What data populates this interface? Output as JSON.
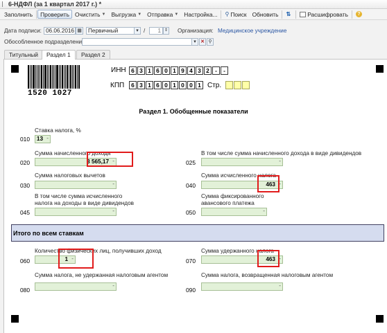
{
  "window": {
    "title": "6-НДФЛ (за 1 квартал 2017 г.) *"
  },
  "toolbar": {
    "fill": "Заполнить",
    "check": "Проверить",
    "clear": "Очистить",
    "export": "Выгрузка",
    "send": "Отправка",
    "settings": "Настройка...",
    "search": "Поиск",
    "refresh": "Обновить",
    "decode": "Расшифровать"
  },
  "header": {
    "date_label": "Дата подписи:",
    "date_value": "06.06.2016",
    "type_value": "Первичный",
    "slash": "/",
    "correction_value": "1",
    "org_label": "Организация:",
    "org_value": "Медицинское учреждение",
    "subdiv_label": "Обособленное подразделение:",
    "subdiv_value": ""
  },
  "tabs": [
    {
      "label": "Титульный"
    },
    {
      "label": "Раздел 1"
    },
    {
      "label": "Раздел 2"
    }
  ],
  "doc": {
    "barcode_number": "1520 1027",
    "inn_label": "ИНН",
    "inn_digits": [
      "6",
      "3",
      "1",
      "6",
      "0",
      "1",
      "9",
      "4",
      "3",
      "2",
      "-",
      "-"
    ],
    "kpp_label": "КПП",
    "kpp_digits": [
      "6",
      "3",
      "1",
      "6",
      "0",
      "1",
      "0",
      "0",
      "1"
    ],
    "page_label": "Стр.",
    "page_digits": [
      "",
      "",
      ""
    ],
    "section_title": "Раздел 1. Обобщенные показатели",
    "fields": {
      "f010": {
        "code": "010",
        "label": "Ставка налога, %",
        "value": "13"
      },
      "f020": {
        "code": "020",
        "label": "Сумма начисленного дохода",
        "value": "3 565,17"
      },
      "f025": {
        "code": "025",
        "label": "В том числе сумма начисленного дохода в виде дивидендов",
        "value": ""
      },
      "f030": {
        "code": "030",
        "label": "Сумма налоговых вычетов",
        "value": ""
      },
      "f040": {
        "code": "040",
        "label": "Сумма исчисленного налога",
        "value": "463"
      },
      "f045": {
        "code": "045",
        "label1": "В том числе сумма исчисленного",
        "label2": "налога на доходы в виде дивидендов",
        "value": ""
      },
      "f050": {
        "code": "050",
        "label1": "Сумма фиксированного",
        "label2": "авансового платежа",
        "value": ""
      }
    },
    "total_bar": "Итого по всем ставкам",
    "fields2": {
      "f060": {
        "code": "060",
        "label": "Количество физических лиц, получивших доход",
        "value": "1"
      },
      "f070": {
        "code": "070",
        "label": "Сумма удержанного налога",
        "value": "463"
      },
      "f080": {
        "code": "080",
        "label": "Сумма налога, не удержанная налоговым агентом",
        "value": ""
      },
      "f090": {
        "code": "090",
        "label": "Сумма налога, возвращенная налоговым агентом",
        "value": ""
      }
    }
  },
  "colors": {
    "highlight": "#e11b1b",
    "input_bg": "#e2f1d8",
    "bar_bg": "#d5dcef",
    "link": "#2a56a3"
  }
}
